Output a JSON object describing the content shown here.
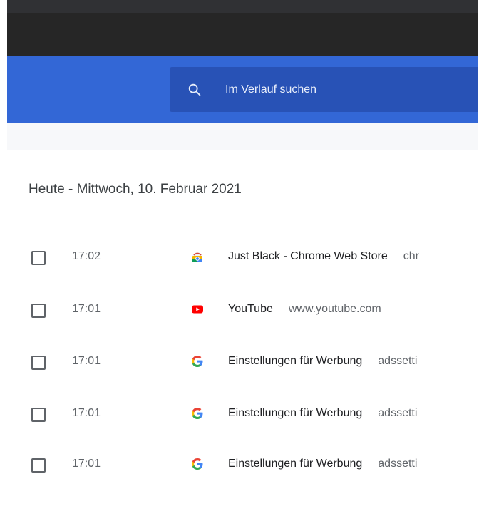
{
  "search": {
    "placeholder": "Im Verlauf suchen",
    "icon": "search-icon"
  },
  "day": {
    "heading": "Heute - Mittwoch, 10. Februar 2021"
  },
  "entries": [
    {
      "time": "17:02",
      "title": "Just Black - Chrome Web Store",
      "domain": "chr",
      "icon": "chrome-web-store-icon"
    },
    {
      "time": "17:01",
      "title": "YouTube",
      "domain": "www.youtube.com",
      "icon": "youtube-icon"
    },
    {
      "time": "17:01",
      "title": "Einstellungen für Werbung",
      "domain": "adssetti",
      "icon": "google-icon"
    },
    {
      "time": "17:01",
      "title": "Einstellungen für Werbung",
      "domain": "adssetti",
      "icon": "google-icon"
    },
    {
      "time": "17:01",
      "title": "Einstellungen für Werbung",
      "domain": "adssetti",
      "icon": "google-icon"
    }
  ],
  "colors": {
    "header_blue": "#3367d6",
    "search_blue": "#2852b6",
    "dark_bar": "#262626"
  }
}
